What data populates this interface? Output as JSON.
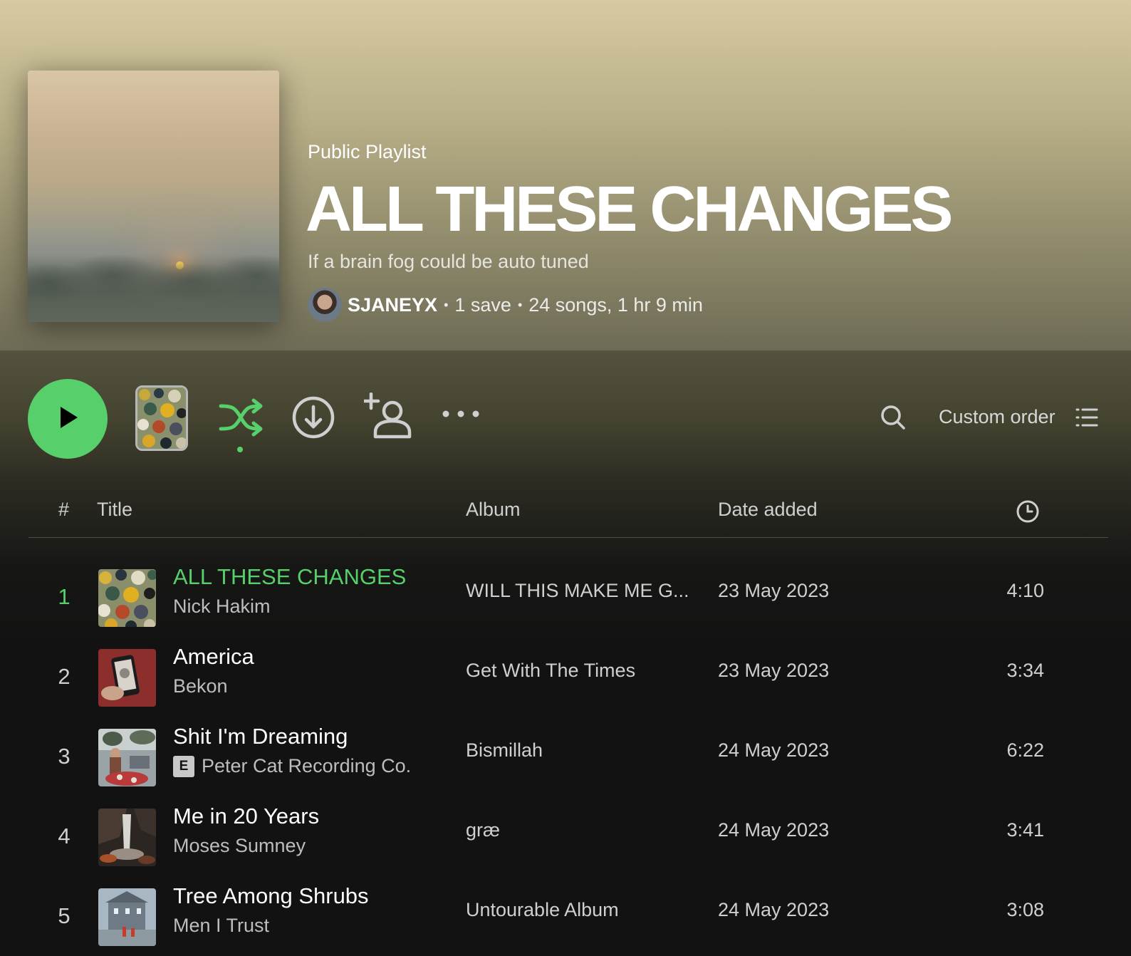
{
  "playlist": {
    "type_label": "Public Playlist",
    "title": "ALL THESE CHANGES",
    "description": "If a brain fog could be auto tuned",
    "owner": "SJANEYX",
    "saves": "1 save",
    "summary": "24 songs, 1 hr 9 min",
    "meta_separator": "•"
  },
  "actions": {
    "play_icon": "play-icon",
    "shuffle_icon": "shuffle-icon",
    "download_icon": "download-icon",
    "invite_icon": "add-collaborator-icon",
    "more_icon": "more-options-icon",
    "search_icon": "search-icon",
    "sort_label": "Custom order",
    "sort_icon": "list-view-icon",
    "accent_color": "#57d06b"
  },
  "columns": {
    "number": "#",
    "title": "Title",
    "album": "Album",
    "date_added": "Date added",
    "duration_icon": "clock-icon"
  },
  "tracks": [
    {
      "num": "1",
      "title": "ALL THESE CHANGES",
      "artist": "Nick Hakim",
      "explicit": false,
      "album": "WILL THIS MAKE ME G...",
      "date": "23 May 2023",
      "duration": "4:10",
      "playing": true
    },
    {
      "num": "2",
      "title": "America",
      "artist": "Bekon",
      "explicit": false,
      "album": "Get With The Times",
      "date": "23 May 2023",
      "duration": "3:34",
      "playing": false
    },
    {
      "num": "3",
      "title": "Shit I'm Dreaming",
      "artist": "Peter Cat Recording Co.",
      "explicit": true,
      "explicit_label": "E",
      "album": "Bismillah",
      "date": "24 May 2023",
      "duration": "6:22",
      "playing": false
    },
    {
      "num": "4",
      "title": "Me in 20 Years",
      "artist": "Moses Sumney",
      "explicit": false,
      "album": "græ",
      "date": "24 May 2023",
      "duration": "3:41",
      "playing": false
    },
    {
      "num": "5",
      "title": "Tree Among Shrubs",
      "artist": "Men I Trust",
      "explicit": false,
      "album": "Untourable Album",
      "date": "24 May 2023",
      "duration": "3:08",
      "playing": false
    }
  ]
}
